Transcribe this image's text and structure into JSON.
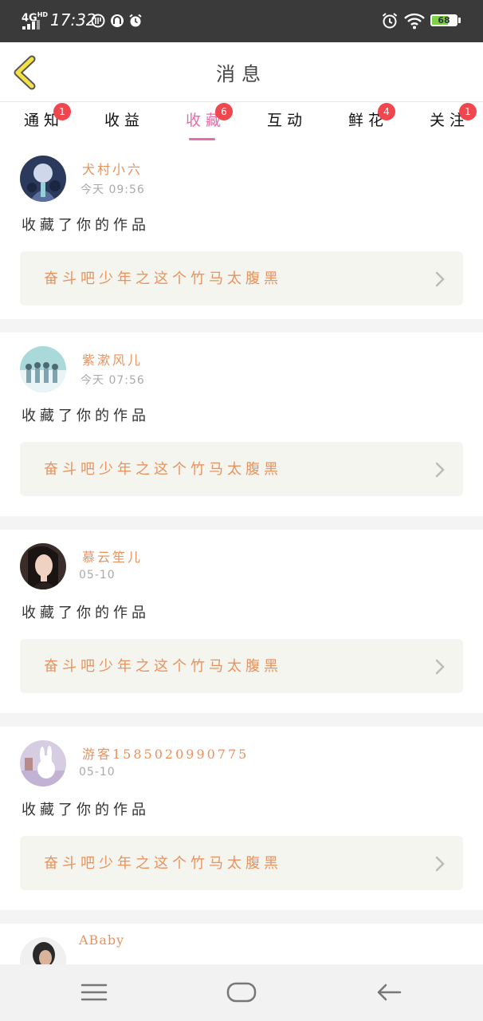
{
  "status_bar": {
    "network": "4G",
    "network_hd": "HD",
    "time": "17:32",
    "battery": "68",
    "icons": [
      "signal-icon",
      "data-saver-icon",
      "app-icon",
      "alarm-icon",
      "alarm-icon",
      "wifi-icon",
      "battery-icon"
    ]
  },
  "header": {
    "title": "消息",
    "back_icon": "chevron-left-icon"
  },
  "tabs": [
    {
      "label": "通知",
      "badge": "1",
      "active": false
    },
    {
      "label": "收益",
      "badge": "",
      "active": false
    },
    {
      "label": "收藏",
      "badge": "6",
      "active": true
    },
    {
      "label": "互动",
      "badge": "",
      "active": false
    },
    {
      "label": "鲜花",
      "badge": "4",
      "active": false
    },
    {
      "label": "关注",
      "badge": "1",
      "active": false
    }
  ],
  "messages": [
    {
      "user": "犬村小六",
      "time": "今天 09:56",
      "action": "收藏了你的作品",
      "work": "奋斗吧少年之这个竹马太腹黑"
    },
    {
      "user": "紫漱风儿",
      "time": "今天 07:56",
      "action": "收藏了你的作品",
      "work": "奋斗吧少年之这个竹马太腹黑"
    },
    {
      "user": "慕云笙儿",
      "time": "05-10",
      "action": "收藏了你的作品",
      "work": "奋斗吧少年之这个竹马太腹黑"
    },
    {
      "user": "游客1585020990775",
      "time": "05-10",
      "action": "收藏了你的作品",
      "work": "奋斗吧少年之这个竹马太腹黑"
    },
    {
      "user": "ABaby",
      "time": "",
      "action": "",
      "work": ""
    }
  ],
  "colors": {
    "accent": "#e86aa6",
    "name": "#e8925e",
    "badge": "#f0474f",
    "card": "#f5f5ef"
  },
  "nav_bar": {
    "icons": [
      "menu-icon",
      "home-icon",
      "back-arrow-icon"
    ]
  }
}
